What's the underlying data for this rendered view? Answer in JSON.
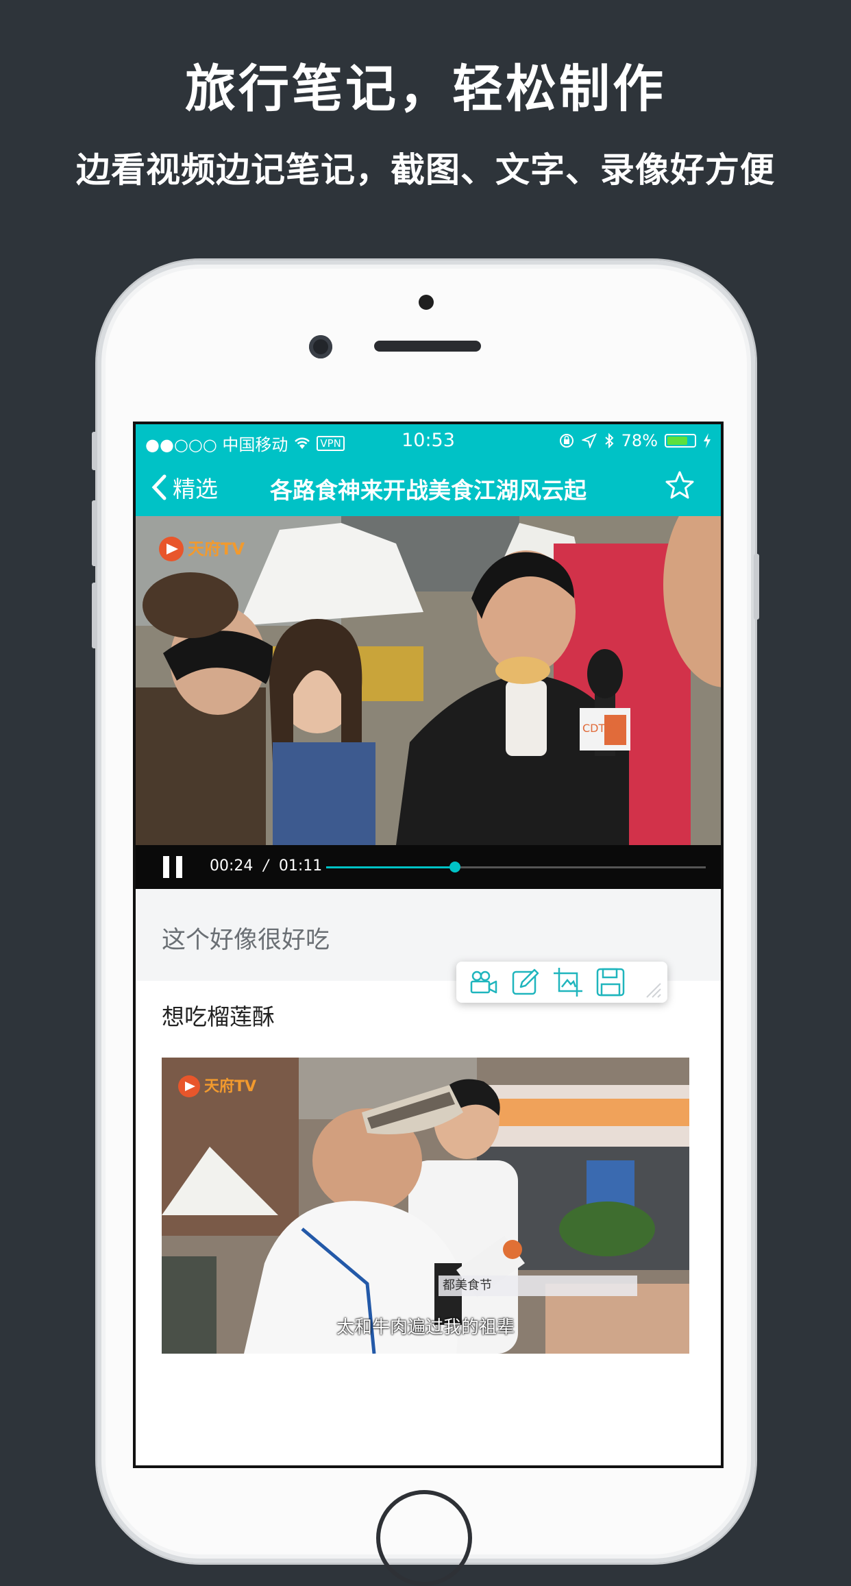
{
  "promo": {
    "headline": "旅行笔记，轻松制作",
    "subline": "边看视频边记笔记，截图、文字、录像好方便"
  },
  "statusbar": {
    "carrier": "●●○○○ 中国移动",
    "vpn": "VPN",
    "time": "10:53",
    "battery": "78%",
    "battery_level": 0.78
  },
  "navbar": {
    "back_label": "精选",
    "title": "各路食神来开战美食江湖风云起"
  },
  "video": {
    "watermark": "天府TV",
    "mic_logo": "CDTV"
  },
  "player": {
    "current_time": "00:24",
    "separator": "/",
    "duration": "01:11",
    "progress": 0.34
  },
  "notes": {
    "note_1": "这个好像很好吃",
    "note_2": "想吃榴莲酥",
    "snapshot_watermark": "天府TV",
    "snapshot_lower_third": "都美食节",
    "snapshot_caption": "太和牛肉遍过我的祖辈"
  },
  "toolbar": {
    "icons": [
      "video-record-icon",
      "edit-text-icon",
      "screenshot-crop-icon",
      "save-icon"
    ]
  },
  "colors": {
    "accent": "#00c2c6",
    "background": "#2e343a"
  }
}
